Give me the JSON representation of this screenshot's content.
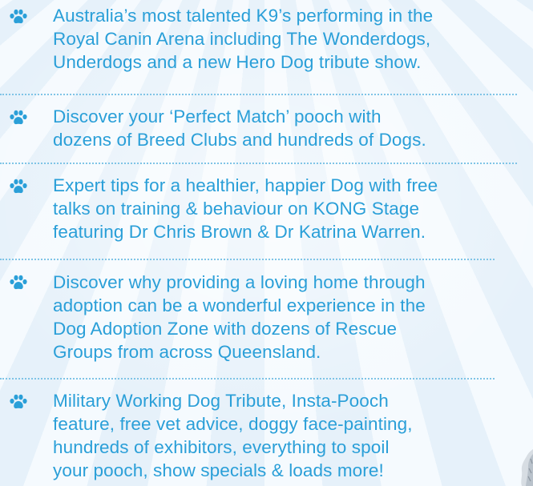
{
  "items": [
    {
      "icon": "paw-icon",
      "lines": [
        "Australia’s most talented K9’s performing in the",
        "Royal Canin Arena including The Wonderdogs,",
        "Underdogs and a new Hero Dog tribute show."
      ]
    },
    {
      "icon": "paw-icon",
      "lines": [
        "Discover your ‘Perfect Match’ pooch with",
        "dozens of Breed Clubs and hundreds of Dogs."
      ]
    },
    {
      "icon": "paw-icon",
      "lines": [
        "Expert tips for a healthier, happier Dog with free",
        "talks on training & behaviour on KONG Stage",
        "featuring Dr Chris Brown & Dr Katrina Warren."
      ]
    },
    {
      "icon": "paw-icon",
      "lines": [
        "Discover why providing a loving home through",
        "adoption can be a wonderful experience in the",
        "Dog Adoption Zone with dozens of Rescue",
        "Groups from across Queensland."
      ]
    },
    {
      "icon": "paw-icon",
      "lines": [
        "Military Working Dog Tribute, Insta-Pooch",
        "feature, free vet advice, doggy face-painting,",
        "hundreds of exhibitors, everything to spoil",
        "your pooch, show specials & loads more!"
      ]
    }
  ],
  "colors": {
    "text": "#2a9fd8",
    "icon": "#2a9fd8",
    "divider": "#7fc4e6",
    "background": "#eef6fc"
  }
}
